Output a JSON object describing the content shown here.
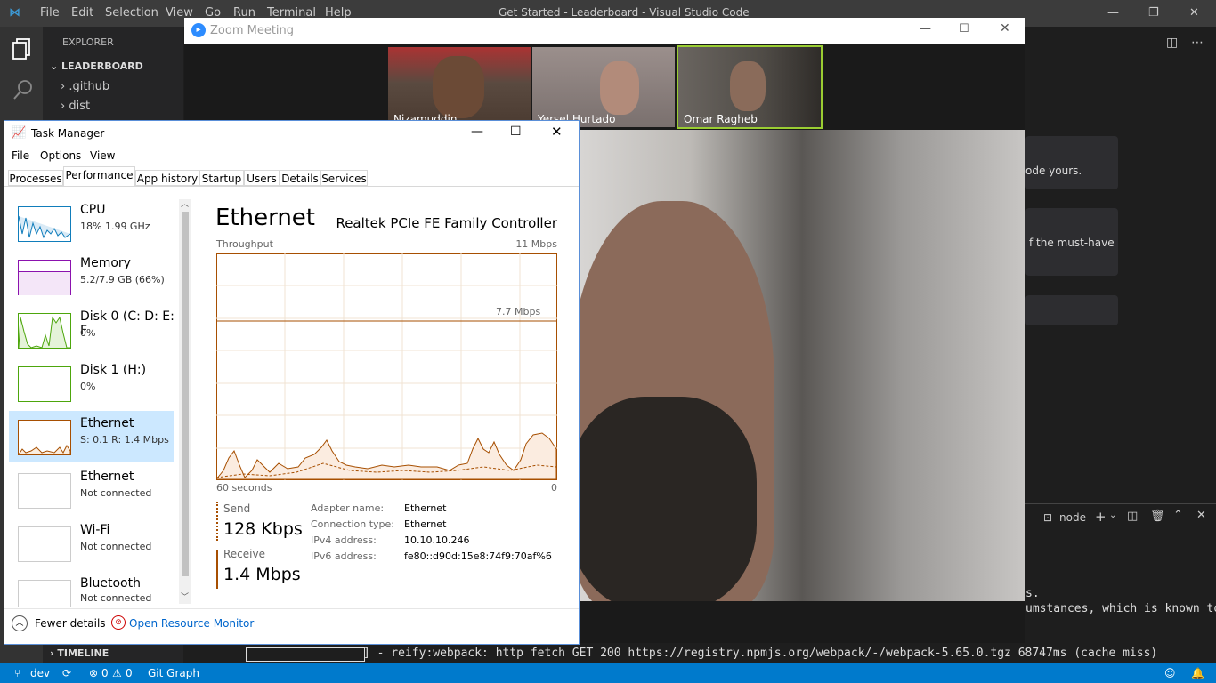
{
  "vscode": {
    "title": "Get Started - Leaderboard - Visual Studio Code",
    "menu": [
      "File",
      "Edit",
      "Selection",
      "View",
      "Go",
      "Run",
      "Terminal",
      "Help"
    ],
    "explorer_label": "EXPLORER",
    "folder": "LEADERBOARD",
    "tree": [
      ".github",
      "dist"
    ],
    "timeline": "TIMELINE",
    "cards": [
      "ode yours.",
      "f the must-have"
    ],
    "terminal_tab": "node",
    "terminal_lines": [
      "s.",
      "umstances, which is known to"
    ],
    "terminal_fetch": "] - reify:webpack: http fetch GET 200 https://registry.npmjs.org/webpack/-/webpack-5.65.0.tgz 68747ms (cache miss)",
    "status": {
      "branch": "dev",
      "errors": "0",
      "warnings": "0",
      "git_graph": "Git Graph"
    }
  },
  "zoom": {
    "title": "Zoom Meeting",
    "participants": [
      "Nizamuddin",
      "Yersel Hurtado",
      "Omar Ragheb"
    ]
  },
  "taskmanager": {
    "title": "Task Manager",
    "menu": [
      "File",
      "Options",
      "View"
    ],
    "tabs": [
      "Processes",
      "Performance",
      "App history",
      "Startup",
      "Users",
      "Details",
      "Services"
    ],
    "side": [
      {
        "name": "CPU",
        "detail": "18%  1.99 GHz"
      },
      {
        "name": "Memory",
        "detail": "5.2/7.9 GB (66%)"
      },
      {
        "name": "Disk 0 (C: D: E: F",
        "detail": "0%"
      },
      {
        "name": "Disk 1 (H:)",
        "detail": "0%"
      },
      {
        "name": "Ethernet",
        "detail": "S: 0.1  R: 1.4 Mbps"
      },
      {
        "name": "Ethernet",
        "detail": "Not connected"
      },
      {
        "name": "Wi-Fi",
        "detail": "Not connected"
      },
      {
        "name": "Bluetooth",
        "detail": "Not connected"
      }
    ],
    "heading": "Ethernet",
    "adapter_title": "Realtek PCIe FE Family Controller",
    "throughput": "Throughput",
    "max": "11 Mbps",
    "mid": "7.7 Mbps",
    "seconds": "60 seconds",
    "zero": "0",
    "send_label": "Send",
    "send_value": "128 Kbps",
    "receive_label": "Receive",
    "receive_value": "1.4 Mbps",
    "details": [
      {
        "k": "Adapter name:",
        "v": "Ethernet"
      },
      {
        "k": "Connection type:",
        "v": "Ethernet"
      },
      {
        "k": "IPv4 address:",
        "v": "10.10.10.246"
      },
      {
        "k": "IPv6 address:",
        "v": "fe80::d90d:15e8:74f9:70af%6"
      }
    ],
    "fewer_details": "Fewer details",
    "open_monitor": "Open Resource Monitor"
  },
  "colors": {
    "accent": "#007acc",
    "ethernet": "#a74f01",
    "selected": "#cce8ff"
  }
}
